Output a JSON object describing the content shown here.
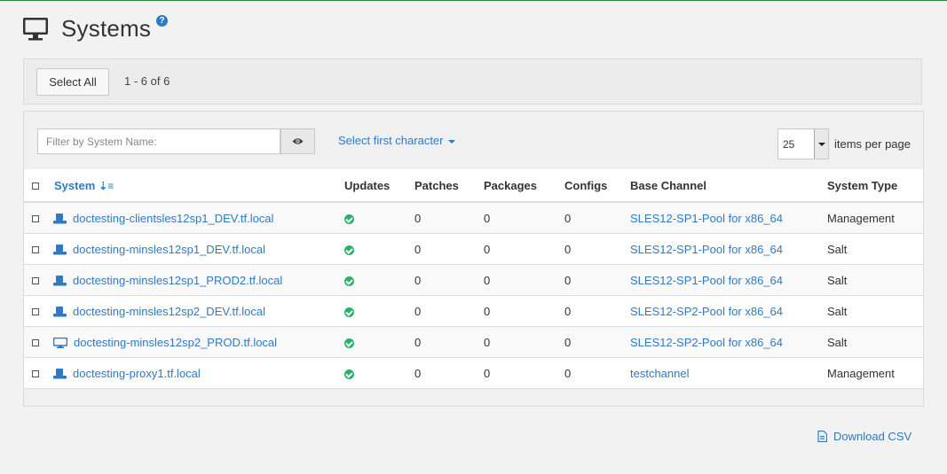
{
  "page": {
    "title": "Systems",
    "help_icon": "question-circle-icon",
    "title_icon": "desktop-monitor-icon"
  },
  "toolbar": {
    "select_all_label": "Select All",
    "range_text": "1 - 6 of 6"
  },
  "filter": {
    "placeholder": "Filter by System Name:",
    "value": "",
    "button_icon": "eye-icon",
    "first_char_label": "Select first character"
  },
  "pagination": {
    "per_page_value": "25",
    "per_page_label": "items per page"
  },
  "table": {
    "columns": {
      "system": "System",
      "updates": "Updates",
      "patches": "Patches",
      "packages": "Packages",
      "configs": "Configs",
      "base_channel": "Base Channel",
      "system_type": "System Type"
    },
    "sort_icon": "sort-alpha-asc-icon",
    "rows": [
      {
        "name": "doctesting-clientsles12sp1_DEV.tf.local",
        "icon": "server-icon",
        "updates_icon": "check-circle-icon",
        "patches": "0",
        "packages": "0",
        "configs": "0",
        "base_channel": "SLES12-SP1-Pool for x86_64",
        "system_type": "Management"
      },
      {
        "name": "doctesting-minsles12sp1_DEV.tf.local",
        "icon": "server-icon",
        "updates_icon": "check-circle-icon",
        "patches": "0",
        "packages": "0",
        "configs": "0",
        "base_channel": "SLES12-SP1-Pool for x86_64",
        "system_type": "Salt"
      },
      {
        "name": "doctesting-minsles12sp1_PROD2.tf.local",
        "icon": "server-icon",
        "updates_icon": "check-circle-icon",
        "patches": "0",
        "packages": "0",
        "configs": "0",
        "base_channel": "SLES12-SP1-Pool for x86_64",
        "system_type": "Salt"
      },
      {
        "name": "doctesting-minsles12sp2_DEV.tf.local",
        "icon": "server-icon",
        "updates_icon": "check-circle-icon",
        "patches": "0",
        "packages": "0",
        "configs": "0",
        "base_channel": "SLES12-SP2-Pool for x86_64",
        "system_type": "Salt"
      },
      {
        "name": "doctesting-minsles12sp2_PROD.tf.local",
        "icon": "desktop-icon",
        "updates_icon": "check-circle-icon",
        "patches": "0",
        "packages": "0",
        "configs": "0",
        "base_channel": "SLES12-SP2-Pool for x86_64",
        "system_type": "Salt"
      },
      {
        "name": "doctesting-proxy1.tf.local",
        "icon": "server-icon",
        "updates_icon": "check-circle-icon",
        "patches": "0",
        "packages": "0",
        "configs": "0",
        "base_channel": "testchannel",
        "system_type": "Management"
      }
    ]
  },
  "footer": {
    "download_label": "Download CSV",
    "download_icon": "file-csv-icon"
  },
  "colors": {
    "link": "#2f7ac4",
    "success": "#2ab26b",
    "top_border": "#2e8b3a"
  }
}
